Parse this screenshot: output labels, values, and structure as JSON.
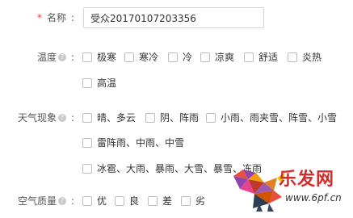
{
  "name": {
    "required_mark": "*",
    "label": "名称",
    "colon": ":",
    "value": "受众20170107203356"
  },
  "temperature": {
    "label": "温度",
    "colon": ":",
    "options": [
      "极寒",
      "寒冷",
      "冷",
      "凉爽",
      "舒适",
      "炎热",
      "高温"
    ]
  },
  "weather": {
    "label": "天气现象",
    "colon": ":",
    "options": [
      "晴、多云",
      "阴、阵雨",
      "小雨、雨夹雪、阵雪、小雪",
      "雷阵雨、中雨、中雪",
      "冰雹、大雨、暴雨、大雪、暴雪、冻雨"
    ]
  },
  "air_quality": {
    "label": "空气质量",
    "colon": ":",
    "options": [
      "优",
      "良",
      "差",
      "劣"
    ]
  },
  "watermark": {
    "title": "乐发网",
    "url": "www.6pf.cn"
  },
  "colors": {
    "required": "#e4393c",
    "watermark_red": "#d62b2b"
  }
}
